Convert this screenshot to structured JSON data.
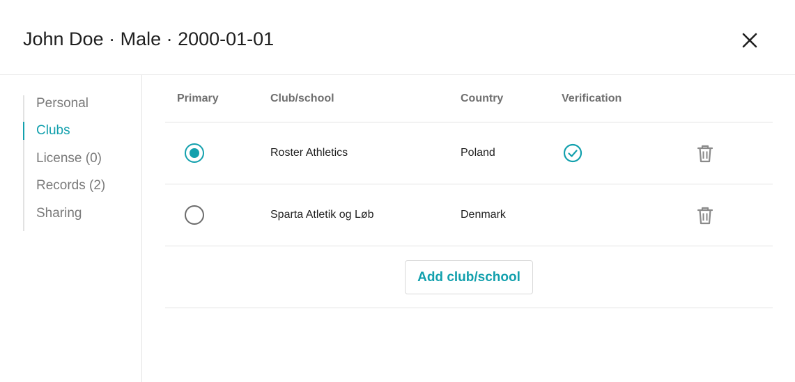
{
  "header": {
    "title": "John Doe · Male · 2000-01-01",
    "close_icon": "close-icon"
  },
  "sidebar": {
    "items": [
      {
        "label": "Personal",
        "active": false
      },
      {
        "label": "Clubs",
        "active": true
      },
      {
        "label": "License (0)",
        "active": false
      },
      {
        "label": "Records (2)",
        "active": false
      },
      {
        "label": "Sharing",
        "active": false
      }
    ]
  },
  "table": {
    "columns": [
      "Primary",
      "Club/school",
      "Country",
      "Verification"
    ],
    "rows": [
      {
        "primary": true,
        "club": "Roster Athletics",
        "country": "Poland",
        "verified": true
      },
      {
        "primary": false,
        "club": "Sparta Atletik og Løb",
        "country": "Denmark",
        "verified": false
      }
    ]
  },
  "actions": {
    "add_label": "Add club/school",
    "delete_icon": "trash-icon",
    "verified_icon": "check-circle-icon"
  },
  "colors": {
    "accent": "#12a0ad",
    "muted_text": "#7a7a7a",
    "divider": "#e2e2e2",
    "icon_gray": "#8a8a8a"
  }
}
